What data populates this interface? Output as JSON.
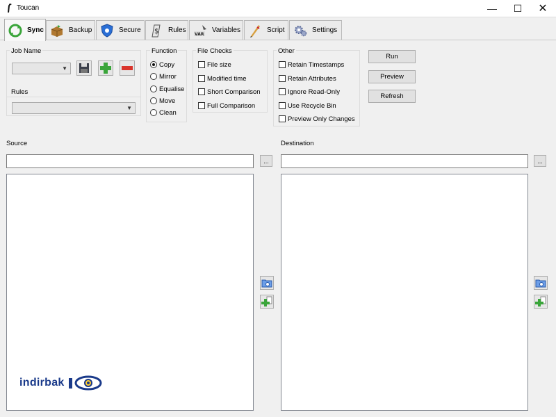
{
  "window": {
    "title": "Toucan"
  },
  "tabs": [
    {
      "label": "Sync",
      "icon": "sync-icon"
    },
    {
      "label": "Backup",
      "icon": "backup-box-icon"
    },
    {
      "label": "Secure",
      "icon": "shield-icon"
    },
    {
      "label": "Rules",
      "icon": "rules-icon"
    },
    {
      "label": "Variables",
      "icon": "variables-icon"
    },
    {
      "label": "Script",
      "icon": "script-icon"
    },
    {
      "label": "Settings",
      "icon": "settings-gears-icon"
    }
  ],
  "job": {
    "label": "Job Name",
    "value": ""
  },
  "rules": {
    "label": "Rules",
    "value": ""
  },
  "function": {
    "label": "Function",
    "options": [
      "Copy",
      "Mirror",
      "Equalise",
      "Move",
      "Clean"
    ],
    "selected": "Copy"
  },
  "file_checks": {
    "label": "File Checks",
    "options": [
      "File size",
      "Modified time",
      "Short Comparison",
      "Full Comparison"
    ]
  },
  "other": {
    "label": "Other",
    "options": [
      "Retain Timestamps",
      "Retain Attributes",
      "Ignore Read-Only",
      "Use Recycle Bin",
      "Preview Only Changes"
    ]
  },
  "actions": {
    "run": "Run",
    "preview": "Preview",
    "refresh": "Refresh"
  },
  "source": {
    "label": "Source",
    "value": "",
    "browse": "..."
  },
  "destination": {
    "label": "Destination",
    "value": "",
    "browse": "..."
  },
  "watermark": {
    "text": "indirbak"
  },
  "colors": {
    "accent_blue": "#1a3a8a",
    "add_green": "#3aa53a",
    "remove_red": "#d9342b"
  }
}
